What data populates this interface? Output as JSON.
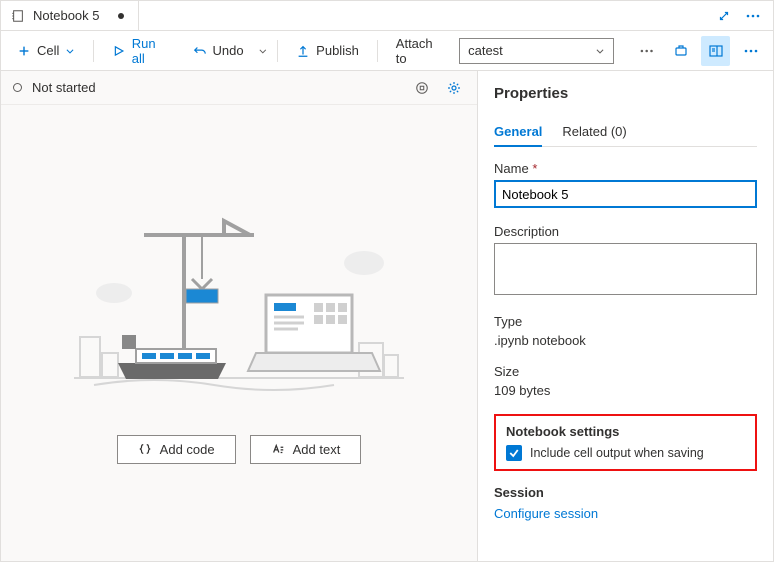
{
  "tab": {
    "title": "Notebook 5"
  },
  "toolbar": {
    "cell": "Cell",
    "run_all": "Run all",
    "undo": "Undo",
    "publish": "Publish",
    "attach_to": "Attach to",
    "attach_value": "catest"
  },
  "status": {
    "label": "Not started"
  },
  "buttons": {
    "add_code": "Add code",
    "add_text": "Add text"
  },
  "properties": {
    "title": "Properties",
    "tabs": {
      "general": "General",
      "related": "Related (0)"
    },
    "name_label": "Name",
    "name_value": "Notebook 5",
    "description_label": "Description",
    "type_label": "Type",
    "type_value": ".ipynb notebook",
    "size_label": "Size",
    "size_value": "109 bytes",
    "settings_title": "Notebook settings",
    "settings_checkbox": "Include cell output when saving",
    "session_title": "Session",
    "configure_link": "Configure session"
  }
}
